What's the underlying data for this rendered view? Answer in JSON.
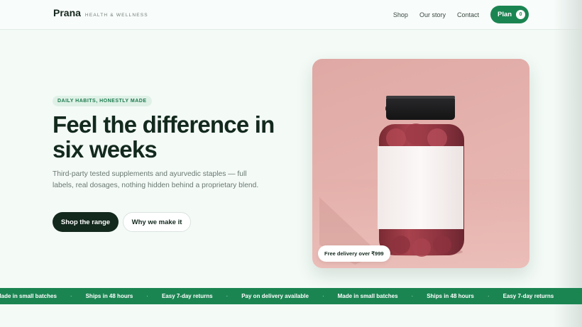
{
  "header": {
    "brand_name": "Prana",
    "brand_tagline": "HEALTH & WELLNESS",
    "nav": [
      {
        "label": "Shop"
      },
      {
        "label": "Our story"
      },
      {
        "label": "Contact"
      }
    ],
    "plan_label": "Plan",
    "plan_count": "0"
  },
  "hero": {
    "eyebrow": "DAILY HABITS, HONESTLY MADE",
    "headline": "Feel the difference in six weeks",
    "lede": "Third-party tested supplements and ayurvedic staples — full labels, real dosages, nothing hidden behind a proprietary blend.",
    "primary_cta": "Shop the range",
    "secondary_cta": "Why we make it",
    "delivery_badge": "Free delivery over ₹999"
  },
  "ticker": {
    "items": [
      "Made in small batches",
      "Ships in 48 hours",
      "Easy 7-day returns",
      "Pay on delivery available",
      "Made in small batches",
      "Ships in 48 hours",
      "Easy 7-day returns"
    ],
    "separator": "·"
  },
  "colors": {
    "accent": "#1b8552",
    "ink": "#14291e",
    "background": "#f4fbf7",
    "photo_backdrop": "#e6b3ae"
  }
}
